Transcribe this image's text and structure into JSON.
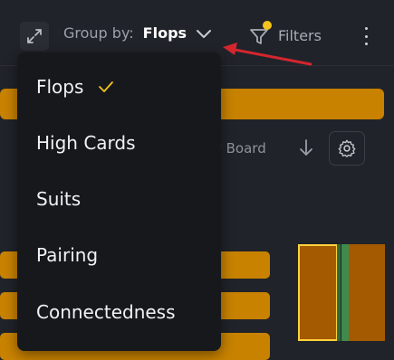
{
  "toolbar": {
    "group_by_label": "Group by:",
    "group_by_value": "Flops",
    "filters_label": "Filters"
  },
  "dropdown": {
    "options": [
      {
        "label": "Flops",
        "selected": true
      },
      {
        "label": "High Cards",
        "selected": false
      },
      {
        "label": "Suits",
        "selected": false
      },
      {
        "label": "Pairing",
        "selected": false
      },
      {
        "label": "Connectedness",
        "selected": false
      }
    ]
  },
  "background": {
    "sort_by_text": "y Board"
  },
  "colors": {
    "accent_orange": "#c88200",
    "dark_orange": "#a45a00",
    "green": "#3f8a4d",
    "highlight_yellow": "#ffd23c",
    "check_yellow": "#f5c31a",
    "annotation_red": "#d3262e",
    "panel_bg": "#16181c",
    "page_bg": "#202329"
  },
  "icons": {
    "expand": "expand-icon",
    "chevron": "chevron-down-icon",
    "filter": "filter-icon",
    "more": "kebab-menu-icon",
    "check": "checkmark-icon",
    "sort": "arrow-down-icon",
    "settings": "gear-icon"
  }
}
